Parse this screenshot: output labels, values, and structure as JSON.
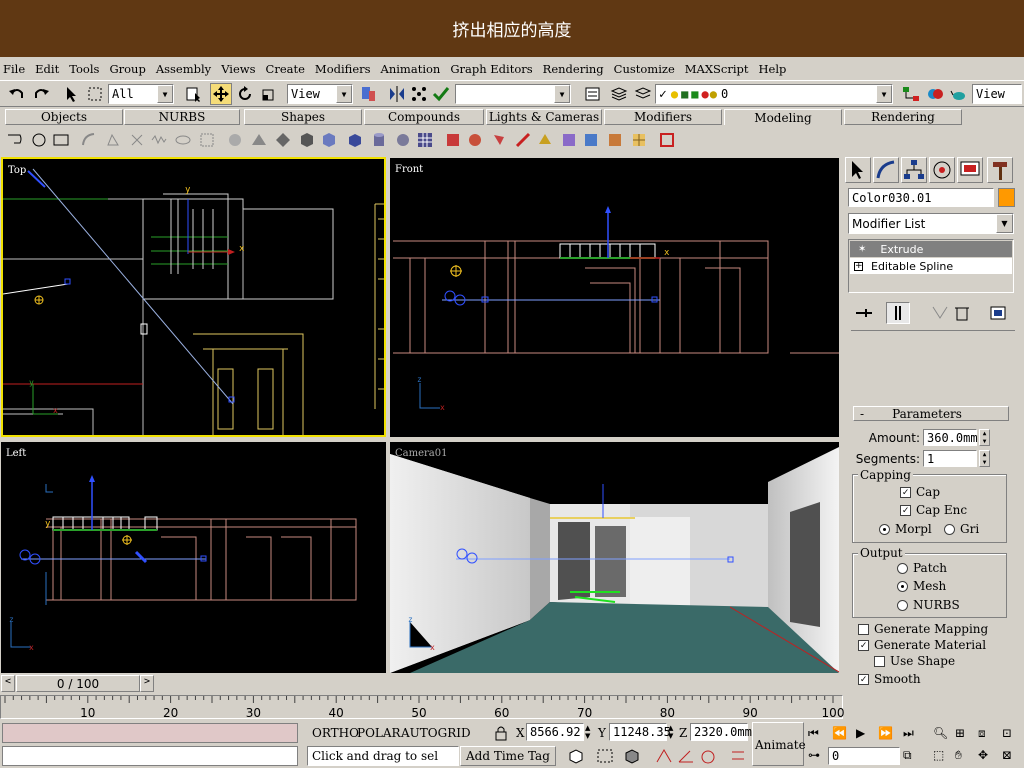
{
  "banner": {
    "title": "挤出相应的高度"
  },
  "menu": [
    "File",
    "Edit",
    "Tools",
    "Group",
    "Assembly",
    "Views",
    "Create",
    "Modifiers",
    "Animation",
    "Graph Editors",
    "Rendering",
    "Customize",
    "MAXScript",
    "Help"
  ],
  "toolbar": {
    "selection_filter": "All",
    "ref_coord": "View",
    "named_selection": "",
    "layer_value": "0",
    "render_type": "View"
  },
  "tabs": [
    "Objects",
    "NURBS",
    "Shapes",
    "Compounds",
    "Lights & Cameras",
    "Modifiers",
    "Modeling",
    "Rendering"
  ],
  "active_tab": "Modeling",
  "viewports": {
    "top": "Top",
    "front": "Front",
    "left": "Left",
    "camera": "Camera01"
  },
  "command_panel": {
    "object_name": "Color030.01",
    "object_color": "#ff9900",
    "modifier_list": "Modifier List",
    "stack": [
      "Extrude",
      "Editable Spline"
    ],
    "rollout_title": "Parameters",
    "amount_label": "Amount:",
    "amount_value": "360.0mm",
    "segments_label": "Segments:",
    "segments_value": "1",
    "capping_title": "Capping",
    "cap_start": "Cap",
    "cap_end": "Cap Enc",
    "morph": "Morpl",
    "grid": "Gri",
    "output_title": "Output",
    "patch": "Patch",
    "mesh": "Mesh",
    "nurbs": "NURBS",
    "gen_mapping": "Generate Mapping",
    "gen_material": "Generate Material",
    "use_shape": "Use Shape",
    "smooth": "Smooth"
  },
  "timeline": {
    "frame_display": "0 / 100",
    "ticks": [
      "10",
      "20",
      "30",
      "40",
      "50",
      "60",
      "70",
      "80",
      "90",
      "100"
    ]
  },
  "status": {
    "ortho": "ORTHO",
    "polar": "POLAR",
    "autogrid": "AUTOGRID",
    "x_label": "X",
    "x_value": "8566.92",
    "y_label": "Y",
    "y_value": "11248.35",
    "z_label": "Z",
    "z_value": "2320.0mm",
    "prompt": "Click and drag to sel",
    "add_time_tag": "Add Time Tag",
    "animate": "Animate",
    "frame_field": "0"
  }
}
